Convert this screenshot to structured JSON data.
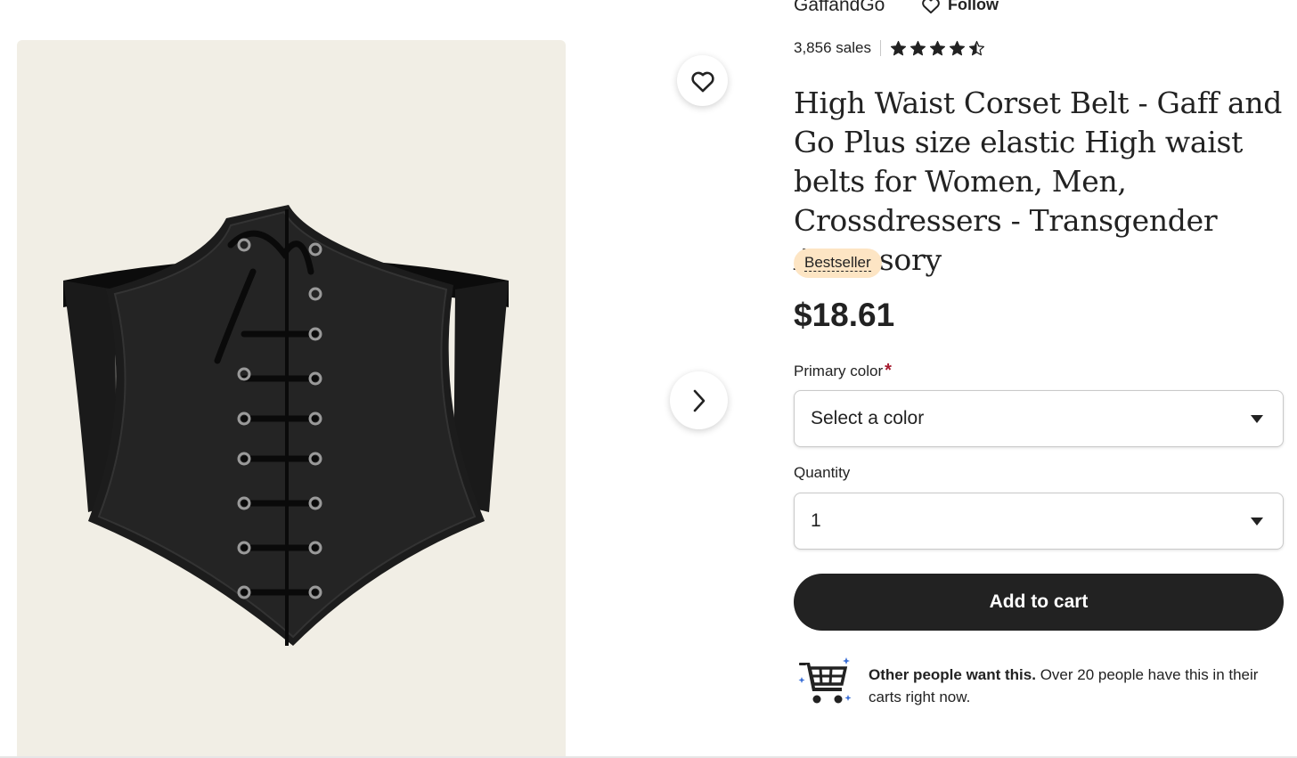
{
  "shop": {
    "name": "GaffandGo",
    "follow_label": "Follow"
  },
  "stats": {
    "sales": "3,856 sales",
    "rating": 4.5,
    "rating_max": 5
  },
  "product": {
    "title": "High Waist Corset Belt - Gaff and Go Plus size elastic High waist belts for Women, Men, Crossdressers - Transgender Accessory",
    "badge": "Bestseller",
    "price": "$18.61"
  },
  "options": {
    "color_label": "Primary color",
    "color_required": "*",
    "color_value": "Select a color",
    "quantity_label": "Quantity",
    "quantity_value": "1"
  },
  "actions": {
    "add_to_cart": "Add to cart"
  },
  "social_proof": {
    "headline": "Other people want this.",
    "body": " Over 20 people have this in their carts right now."
  },
  "colors": {
    "image_bg": "#f1eee5",
    "badge_bg": "#fde5c4",
    "button_bg": "#222222",
    "required": "#a61a2e"
  },
  "icons": {
    "favorite": "heart-outline-icon",
    "next": "chevron-right-icon",
    "follow": "heart-outline-icon",
    "cart": "shopping-cart-icon"
  }
}
